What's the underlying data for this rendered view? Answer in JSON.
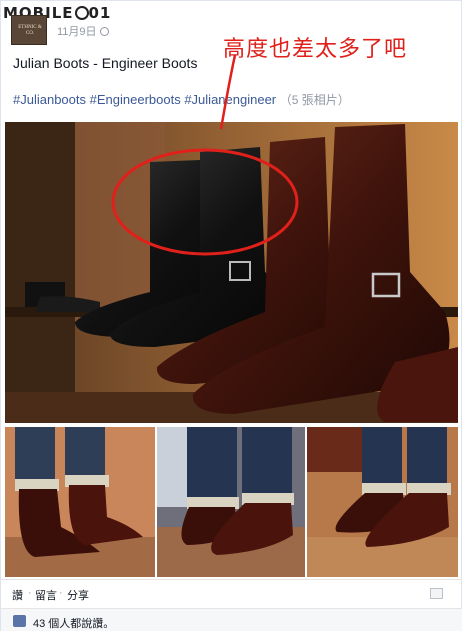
{
  "watermark": {
    "text": "MOBILE",
    "suffix": "01"
  },
  "post": {
    "avatar_label": "ETHNIC & CO.",
    "date": "11月9日",
    "annotation": "高度也差太多了吧",
    "title": "Julian Boots - Engineer Boots",
    "hashtags": [
      "#Julianboots",
      "#Engineerboots",
      "#Julianengineer"
    ],
    "photo_count": "（5 張相片）"
  },
  "actions": {
    "like": "讚",
    "comment": "留言",
    "share": "分享",
    "separator": "·"
  },
  "likes": {
    "text": "43 個人都說讚。"
  },
  "colors": {
    "annotation": "#e0201b",
    "link": "#3b5998",
    "meta": "#9197a3"
  }
}
